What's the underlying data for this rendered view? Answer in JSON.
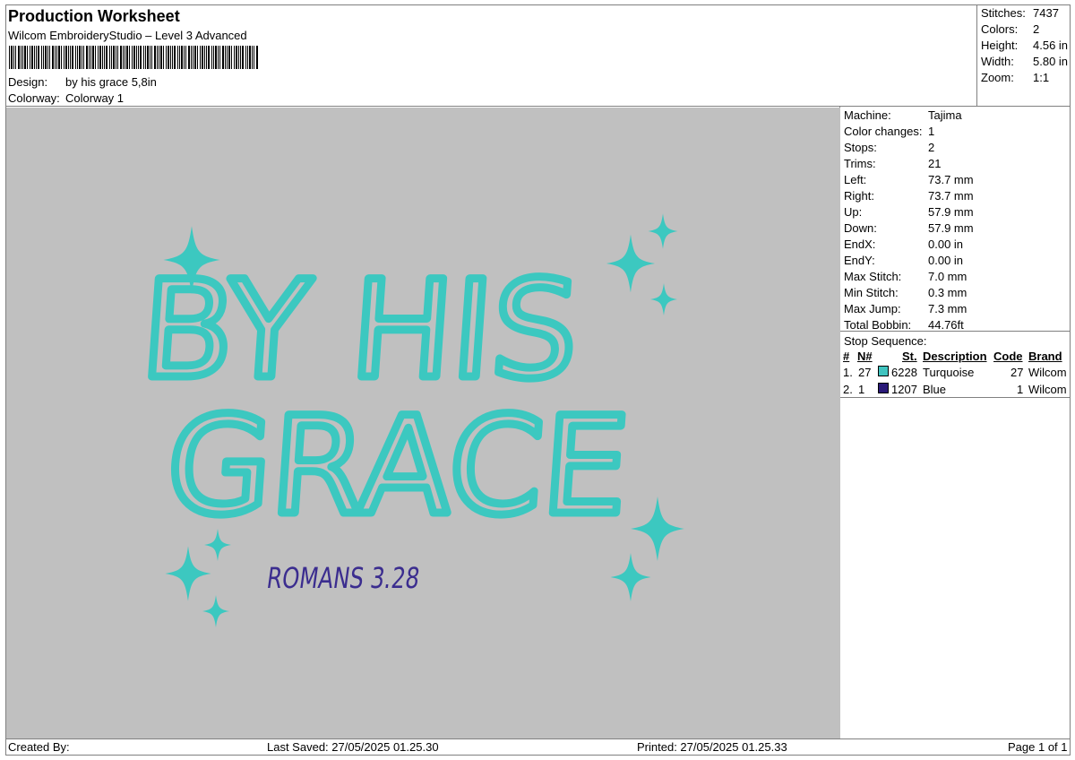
{
  "header": {
    "title": "Production Worksheet",
    "software": "Wilcom EmbroideryStudio – Level 3 Advanced",
    "design_label": "Design:",
    "design_value": "by his grace 5,8in",
    "colorway_label": "Colorway:",
    "colorway_value": "Colorway 1"
  },
  "summary": [
    {
      "label": "Stitches:",
      "value": "7437"
    },
    {
      "label": "Colors:",
      "value": "2"
    },
    {
      "label": "Height:",
      "value": "4.56 in"
    },
    {
      "label": "Width:",
      "value": "5.80 in"
    },
    {
      "label": "Zoom:",
      "value": "1:1"
    }
  ],
  "machine_info": [
    {
      "label": "Machine:",
      "value": "Tajima"
    },
    {
      "label": "Color changes:",
      "value": "1"
    },
    {
      "label": "Stops:",
      "value": "2"
    },
    {
      "label": "Trims:",
      "value": "21"
    },
    {
      "label": "Left:",
      "value": "73.7 mm"
    },
    {
      "label": "Right:",
      "value": "73.7 mm"
    },
    {
      "label": "Up:",
      "value": "57.9 mm"
    },
    {
      "label": "Down:",
      "value": "57.9 mm"
    },
    {
      "label": "EndX:",
      "value": "0.00 in"
    },
    {
      "label": "EndY:",
      "value": "0.00 in"
    },
    {
      "label": "Max Stitch:",
      "value": "7.0 mm"
    },
    {
      "label": "Min Stitch:",
      "value": "0.3 mm"
    },
    {
      "label": "Max Jump:",
      "value": "7.3 mm"
    },
    {
      "label": "Total Bobbin:",
      "value": "44.76ft"
    }
  ],
  "stop_sequence": {
    "title": "Stop Sequence:",
    "headers": {
      "num": "#",
      "n": "N#",
      "st": "St.",
      "desc": "Description",
      "code": "Code",
      "brand": "Brand"
    },
    "rows": [
      {
        "num": "1.",
        "n": "27",
        "color": "#40c4c0",
        "st": "6228",
        "desc": "Turquoise",
        "code": "27",
        "brand": "Wilcom"
      },
      {
        "num": "2.",
        "n": "1",
        "color": "#2a1a78",
        "st": "1207",
        "desc": "Blue",
        "code": "1",
        "brand": "Wilcom"
      }
    ]
  },
  "design": {
    "line1": "BY HIS",
    "line2": "GRACE",
    "line3": "ROMANS 3.28",
    "thread_color_main": "#3cc8c0",
    "thread_color_second": "#3b2d8f",
    "background": "#c0c0c0"
  },
  "footer": {
    "created_by": "Created By:",
    "last_saved": "Last Saved: 27/05/2025 01.25.30",
    "printed": "Printed: 27/05/2025 01.25.33",
    "page": "Page 1 of 1"
  }
}
